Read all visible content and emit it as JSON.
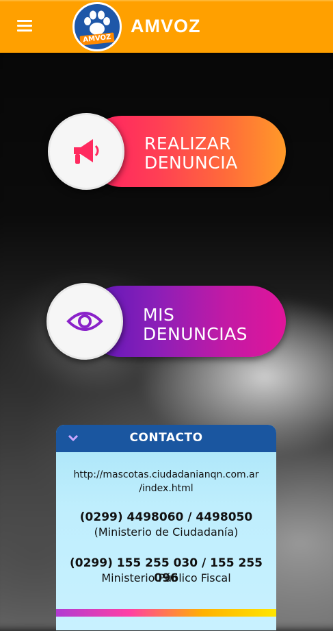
{
  "app": {
    "title": "AMVOZ",
    "logo_text": "AMVOZ"
  },
  "actions": [
    {
      "label_line1": "REALIZAR",
      "label_line2": "DENUNCIA",
      "icon": "megaphone-icon"
    },
    {
      "label_line1": "MIS",
      "label_line2": "DENUNCIAS",
      "icon": "eye-icon"
    }
  ],
  "contact": {
    "title": "CONTACTO",
    "url_line1": "http://mascotas.ciudadanianqn.com.ar",
    "url_line2": "/index.html",
    "phone1": "(0299) 4498060 / 4498050",
    "org1": "(Ministerio de Ciudadanía)",
    "phone2": "(0299) 155 255 030 / 155 255 096",
    "org2": "Ministerio Público Fiscal"
  },
  "colors": {
    "appbar": "#ffa000",
    "contact_header": "#1a56a0",
    "contact_body": "#bfeefd"
  }
}
